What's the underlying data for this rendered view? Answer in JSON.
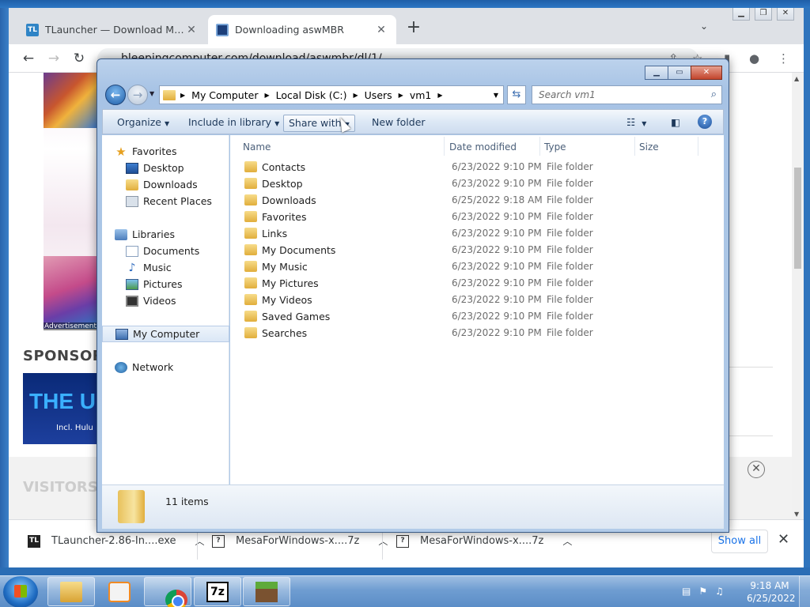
{
  "chrome": {
    "tabs": [
      {
        "title": "TLauncher — Download Minecra",
        "favicon": "TL",
        "active": false
      },
      {
        "title": "Downloading aswMBR",
        "active": true
      }
    ],
    "url": "bleepingcomputer.com/download/aswmbr/dl/1/",
    "new_tab_icon": "+",
    "tab_search_icon": "chevron-down",
    "window_controls": [
      "minimize",
      "restore",
      "close"
    ]
  },
  "page": {
    "ad_label": "Advertisement",
    "sponsor_heading": "SPONSOR",
    "banner_text": "THE U",
    "banner_subtext": "Incl. Hulu (a",
    "visitors_heading": "VISITORS"
  },
  "downloads": {
    "items": [
      {
        "name": "TLauncher-2.86-In....exe",
        "icon_text": "TL"
      },
      {
        "name": "MesaForWindows-x....7z",
        "icon_text": "?"
      },
      {
        "name": "MesaForWindows-x....7z",
        "icon_text": "?"
      }
    ],
    "show_all": "Show all"
  },
  "explorer": {
    "breadcrumbs": [
      "My Computer",
      "Local Disk (C:)",
      "Users",
      "vm1"
    ],
    "search_placeholder": "Search vm1",
    "commands": {
      "organize": "Organize",
      "include_in_library": "Include in library",
      "share_with": "Share with",
      "new_folder": "New folder"
    },
    "nav": {
      "favorites": "Favorites",
      "favorites_items": [
        "Desktop",
        "Downloads",
        "Recent Places"
      ],
      "libraries": "Libraries",
      "libraries_items": [
        "Documents",
        "Music",
        "Pictures",
        "Videos"
      ],
      "computer": "My Computer",
      "network": "Network"
    },
    "columns": {
      "name": "Name",
      "date": "Date modified",
      "type": "Type",
      "size": "Size"
    },
    "files": [
      {
        "name": "Contacts",
        "date": "6/23/2022 9:10 PM",
        "type": "File folder"
      },
      {
        "name": "Desktop",
        "date": "6/23/2022 9:10 PM",
        "type": "File folder"
      },
      {
        "name": "Downloads",
        "date": "6/25/2022 9:18 AM",
        "type": "File folder"
      },
      {
        "name": "Favorites",
        "date": "6/23/2022 9:10 PM",
        "type": "File folder"
      },
      {
        "name": "Links",
        "date": "6/23/2022 9:10 PM",
        "type": "File folder"
      },
      {
        "name": "My Documents",
        "date": "6/23/2022 9:10 PM",
        "type": "File folder"
      },
      {
        "name": "My Music",
        "date": "6/23/2022 9:10 PM",
        "type": "File folder"
      },
      {
        "name": "My Pictures",
        "date": "6/23/2022 9:10 PM",
        "type": "File folder"
      },
      {
        "name": "My Videos",
        "date": "6/23/2022 9:10 PM",
        "type": "File folder"
      },
      {
        "name": "Saved Games",
        "date": "6/23/2022 9:10 PM",
        "type": "File folder"
      },
      {
        "name": "Searches",
        "date": "6/23/2022 9:10 PM",
        "type": "File folder"
      }
    ],
    "item_count": "11 items"
  },
  "taskbar": {
    "apps": [
      "windows-explorer",
      "media-player",
      "chrome",
      "7-zip",
      "minecraft"
    ],
    "zip_label": "7z",
    "time": "9:18 AM",
    "date": "6/25/2022"
  }
}
